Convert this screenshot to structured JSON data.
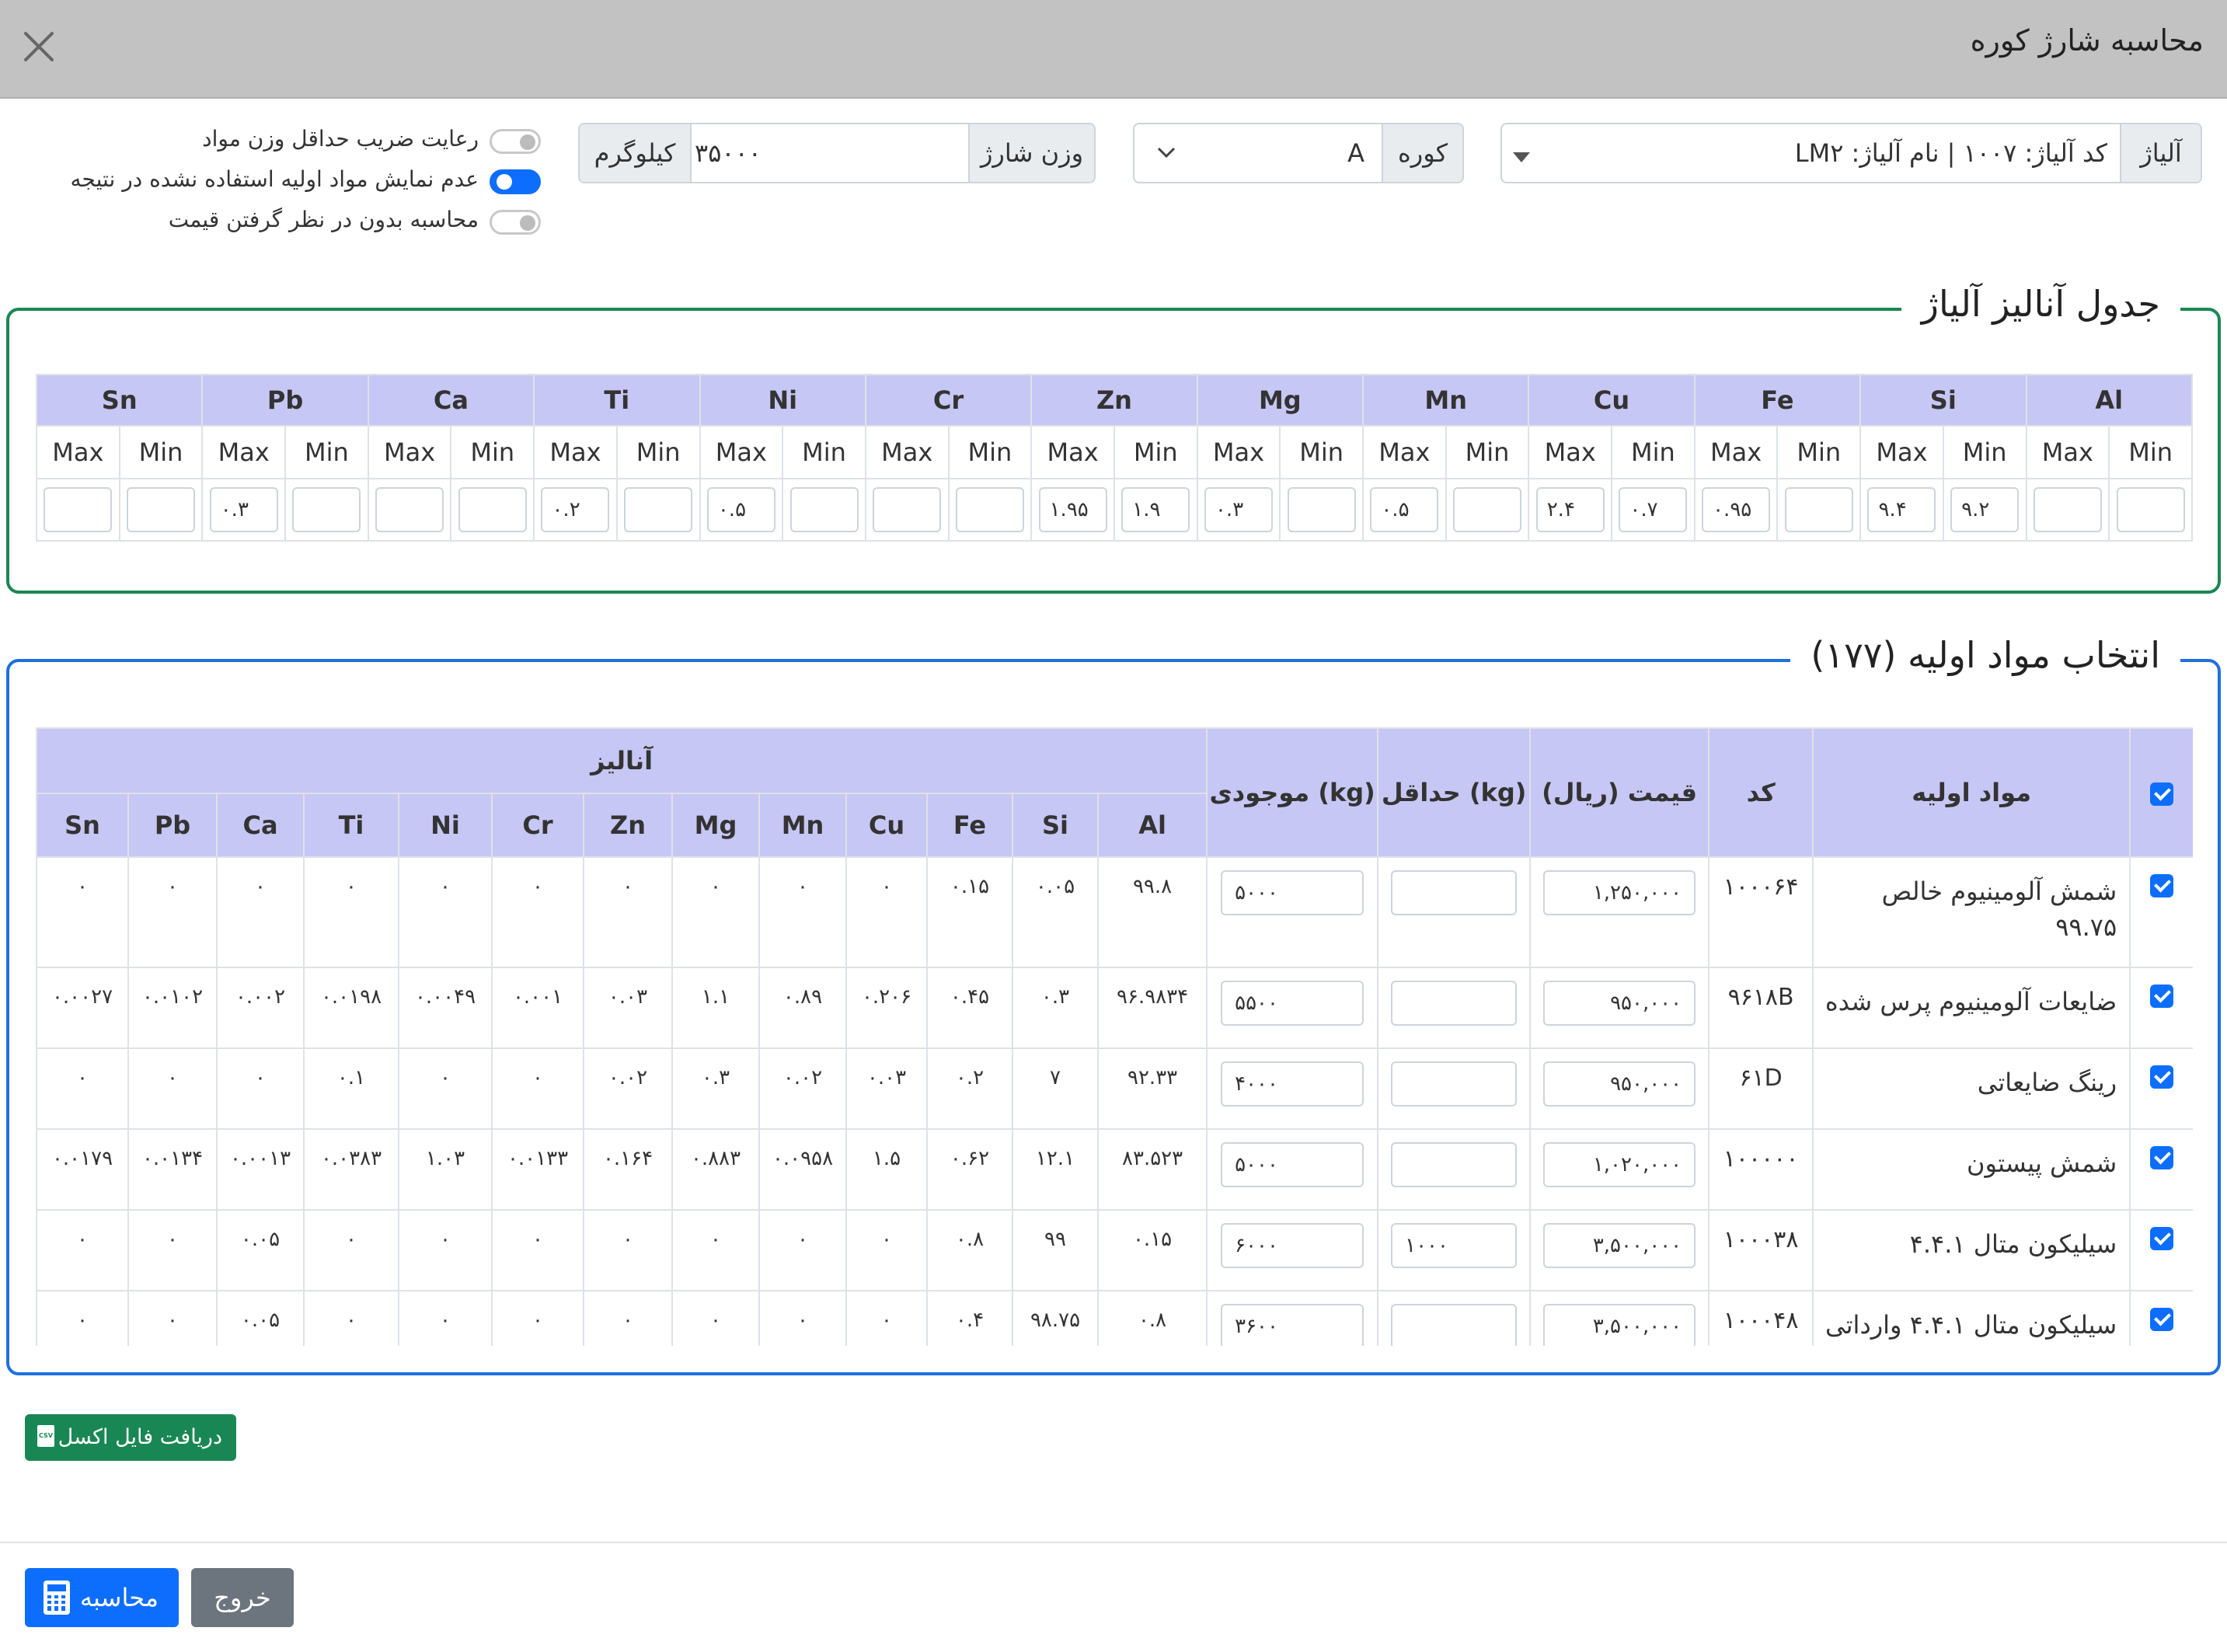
{
  "header": {
    "title": "محاسبه شارژ کوره"
  },
  "form": {
    "alloy_label": "آلیاژ",
    "alloy_value": "کد آلیاژ: ۱۰۰۷ | نام آلیاژ: LM۲",
    "furnace_label": "کوره",
    "furnace_value": "A",
    "charge_weight_label": "وزن شارژ",
    "charge_weight_value": "۳۵۰۰۰",
    "charge_weight_unit": "کیلوگرم"
  },
  "options": [
    {
      "label": "رعایت ضریب حداقل وزن مواد",
      "checked": false
    },
    {
      "label": "عدم نمایش مواد اولیه استفاده نشده در نتیجه",
      "checked": true
    },
    {
      "label": "محاسبه بدون در نظر گرفتن قیمت",
      "checked": false
    }
  ],
  "alloy_analysis": {
    "legend": "جدول آنالیز آلیاژ",
    "min_label": "Min",
    "max_label": "Max",
    "elements": [
      {
        "name": "Al",
        "min": "",
        "max": ""
      },
      {
        "name": "Si",
        "min": "۹.۲",
        "max": "۹.۴"
      },
      {
        "name": "Fe",
        "min": "",
        "max": "۰.۹۵"
      },
      {
        "name": "Cu",
        "min": "۰.۷",
        "max": "۲.۴"
      },
      {
        "name": "Mn",
        "min": "",
        "max": "۰.۵"
      },
      {
        "name": "Mg",
        "min": "",
        "max": "۰.۳"
      },
      {
        "name": "Zn",
        "min": "۱.۹",
        "max": "۱.۹۵"
      },
      {
        "name": "Cr",
        "min": "",
        "max": ""
      },
      {
        "name": "Ni",
        "min": "",
        "max": "۰.۵"
      },
      {
        "name": "Ti",
        "min": "",
        "max": "۰.۲"
      },
      {
        "name": "Ca",
        "min": "",
        "max": ""
      },
      {
        "name": "Pb",
        "min": "",
        "max": "۰.۳"
      },
      {
        "name": "Sn",
        "min": "",
        "max": ""
      }
    ]
  },
  "materials": {
    "legend": "انتخاب مواد اولیه (۱۷۷)",
    "headers": {
      "name": "مواد اولیه",
      "code": "کد",
      "price": "قیمت (ریال)",
      "min": "حداقل (kg)",
      "stock": "موجودی (kg)",
      "analysis": "آنالیز",
      "elements": [
        "Al",
        "Si",
        "Fe",
        "Cu",
        "Mn",
        "Mg",
        "Zn",
        "Cr",
        "Ni",
        "Ti",
        "Ca",
        "Pb",
        "Sn"
      ]
    },
    "rows": [
      {
        "name": "شمش آلومینیوم خالص ۹۹.۷۵",
        "code": "۱۰۰۰۶۴",
        "price": "۱,۲۵۰,۰۰۰",
        "min": "",
        "stock": "۵۰۰۰",
        "analysis": [
          "۹۹.۸",
          "۰.۰۵",
          "۰.۱۵",
          "۰",
          "۰",
          "۰",
          "۰",
          "۰",
          "۰",
          "۰",
          "۰",
          "۰",
          "۰"
        ]
      },
      {
        "name": "ضایعات آلومینیوم پرس شده",
        "code": "۹۶۱۸B",
        "price": "۹۵۰,۰۰۰",
        "min": "",
        "stock": "۵۵۰۰",
        "analysis": [
          "۹۶.۹۸۳۴",
          "۰.۳",
          "۰.۴۵",
          "۰.۲۰۶",
          "۰.۸۹",
          "۱.۱",
          "۰.۰۳",
          "۰.۰۰۱",
          "۰.۰۰۴۹",
          "۰.۰۱۹۸",
          "۰.۰۰۲",
          "۰.۰۱۰۲",
          "۰.۰۰۲۷"
        ]
      },
      {
        "name": "رینگ ضایعاتی",
        "code": "۶۱D",
        "price": "۹۵۰,۰۰۰",
        "min": "",
        "stock": "۴۰۰۰",
        "analysis": [
          "۹۲.۳۳",
          "۷",
          "۰.۲",
          "۰.۰۳",
          "۰.۰۲",
          "۰.۳",
          "۰.۰۲",
          "۰",
          "۰",
          "۰.۱",
          "۰",
          "۰",
          "۰"
        ]
      },
      {
        "name": "شمش پیستون",
        "code": "۱۰۰۰۰۰",
        "price": "۱,۰۲۰,۰۰۰",
        "min": "",
        "stock": "۵۰۰۰",
        "analysis": [
          "۸۳.۵۲۳",
          "۱۲.۱",
          "۰.۶۲",
          "۱.۵",
          "۰.۰۹۵۸",
          "۰.۸۸۳",
          "۰.۱۶۴",
          "۰.۰۱۳۳",
          "۱.۰۳",
          "۰.۰۳۸۳",
          "۰.۰۰۱۳",
          "۰.۰۱۳۴",
          "۰.۰۱۷۹"
        ]
      },
      {
        "name": "سیلیکون متال ۴.۴.۱",
        "code": "۱۰۰۰۳۸",
        "price": "۳,۵۰۰,۰۰۰",
        "min": "۱۰۰۰",
        "stock": "۶۰۰۰",
        "analysis": [
          "۰.۱۵",
          "۹۹",
          "۰.۸",
          "۰",
          "۰",
          "۰",
          "۰",
          "۰",
          "۰",
          "۰",
          "۰.۰۵",
          "۰",
          "۰"
        ]
      },
      {
        "name": "سیلیکون متال ۴.۴.۱ وارداتی",
        "code": "۱۰۰۰۴۸",
        "price": "۳,۵۰۰,۰۰۰",
        "min": "",
        "stock": "۳۶۰۰",
        "analysis": [
          "۰.۸",
          "۹۸.۷۵",
          "۰.۴",
          "۰",
          "۰",
          "۰",
          "۰",
          "۰",
          "۰",
          "۰",
          "۰.۰۵",
          "۰",
          "۰"
        ]
      }
    ]
  },
  "buttons": {
    "excel": "دریافت فایل اکسل",
    "excel_icon": "csv-file-icon",
    "calculate": "محاسبه",
    "calculate_icon": "calculator-icon",
    "exit": "خروج"
  },
  "colors": {
    "header_bg": "#c2c2c2",
    "table_header_bg": "#c7c7f5",
    "primary": "#0d6efd",
    "success_green": "#198754",
    "secondary_gray": "#6c757d",
    "alloy_fieldset_border": "#198754",
    "materials_fieldset_border": "#1f6fe0"
  }
}
